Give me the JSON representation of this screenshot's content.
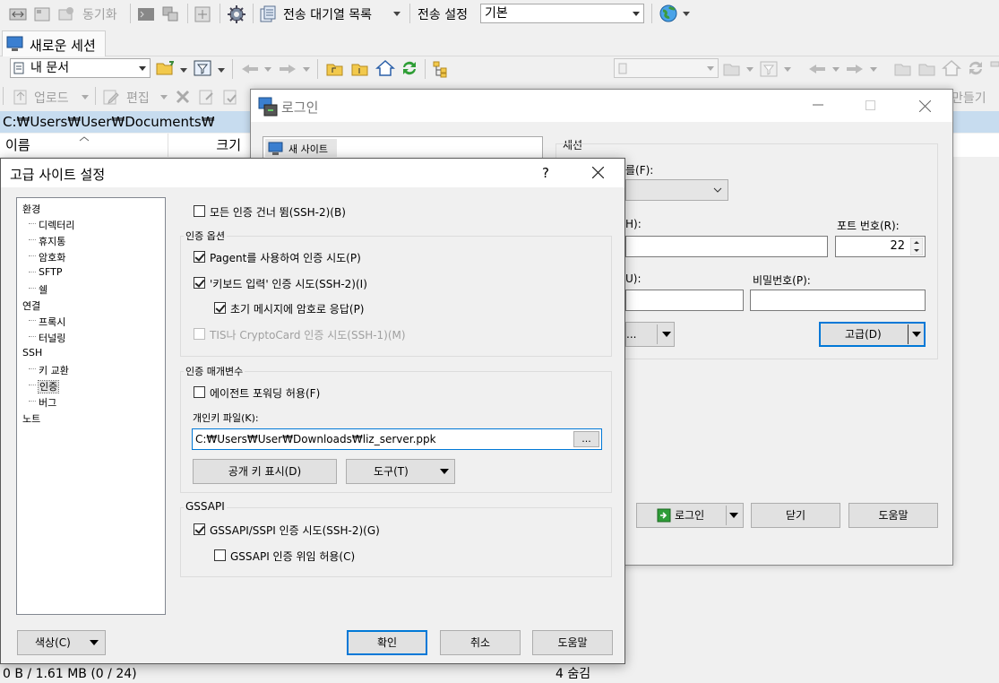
{
  "toolbar1": {
    "sync_label": "동기화",
    "queue_label": "전송 대기열 목록",
    "transfer_settings_label": "전송 설정",
    "transfer_preset_value": "기본"
  },
  "session_tab": {
    "label": "새로운 세션"
  },
  "toolbar2": {
    "location_value": "내 문서"
  },
  "toolbar3": {
    "upload_label": "업로드",
    "edit_label": "편집",
    "create_label": "만들기"
  },
  "file_panel": {
    "path": "C:₩Users₩User₩Documents₩",
    "columns": [
      "이름",
      "크기"
    ]
  },
  "status_bar": {
    "left": "0 B / 1.61 MB (0 / 24)",
    "right": "4 숨김"
  },
  "login": {
    "title": "로그인",
    "new_site_label": "새 사이트",
    "session_group_title": "세션",
    "protocol_label_partial": "를(F):",
    "host_label_partial": "H):",
    "port_label": "포트 번호(R):",
    "port_value": "22",
    "user_label_partial": "U):",
    "password_label": "비밀번호(P):",
    "edit_button_partial": "...",
    "advanced_button": "고급(D)",
    "login_button": "로그인",
    "close_button": "닫기",
    "help_button": "도움말"
  },
  "advanced": {
    "title": "고급 사이트 설정",
    "help_glyph": "?",
    "tree": [
      {
        "label": "환경",
        "level": 0
      },
      {
        "label": "디렉터리",
        "level": 1
      },
      {
        "label": "휴지통",
        "level": 1
      },
      {
        "label": "암호화",
        "level": 1
      },
      {
        "label": "SFTP",
        "level": 1
      },
      {
        "label": "쉘",
        "level": 1
      },
      {
        "label": "연결",
        "level": 0
      },
      {
        "label": "프록시",
        "level": 1
      },
      {
        "label": "터널링",
        "level": 1
      },
      {
        "label": "SSH",
        "level": 0
      },
      {
        "label": "키 교환",
        "level": 1
      },
      {
        "label": "인증",
        "level": 1,
        "selected": true
      },
      {
        "label": "버그",
        "level": 1
      },
      {
        "label": "노트",
        "level": 0
      }
    ],
    "bypass_auth": {
      "label": "모든 인증 건너 뜀(SSH-2)(B)",
      "checked": false
    },
    "auth_options": {
      "title": "인증 옵션",
      "pageant": {
        "label": "Pagent를 사용하여 인증 시도(P)",
        "checked": true
      },
      "keyboard": {
        "label": "'키보드 입력' 인증 시도(SSH-2)(I)",
        "checked": true
      },
      "initial_prompt": {
        "label": "초기 메시지에 암호로 응답(P)",
        "checked": true
      },
      "tis": {
        "label": "TIS나 CryptoCard 인증 시도(SSH-1)(M)",
        "checked": false,
        "disabled": true
      }
    },
    "auth_params": {
      "title": "인증 매개변수",
      "agent_fwd": {
        "label": "에이전트 포워딩 허용(F)",
        "checked": false
      },
      "private_key_label": "개인키 파일(K):",
      "private_key_value": "C:₩Users₩User₩Downloads₩liz_server.ppk",
      "browse_label": "...",
      "show_public_key": "공개 키 표시(D)",
      "tools": "도구(T)"
    },
    "gssapi": {
      "title": "GSSAPI",
      "attempt": {
        "label": "GSSAPI/SSPI 인증 시도(SSH-2)(G)",
        "checked": true
      },
      "delegation": {
        "label": "GSSAPI 인증 위임 허용(C)",
        "checked": false
      }
    },
    "color_button": "색상(C)",
    "ok_button": "확인",
    "cancel_button": "취소",
    "help_button": "도움말"
  },
  "colors": {
    "accent": "#0078d7",
    "path_bar": "#c7dcef"
  }
}
